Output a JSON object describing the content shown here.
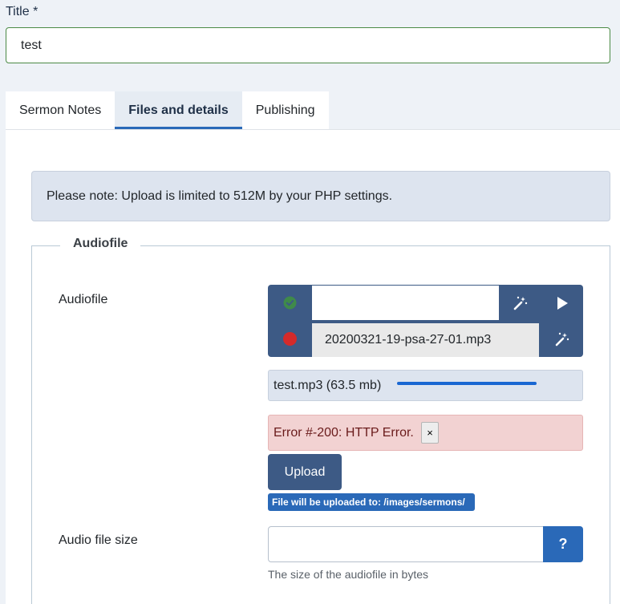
{
  "title_field": {
    "label": "Title *",
    "value": "test"
  },
  "tabs": [
    {
      "label": "Sermon Notes",
      "active": false
    },
    {
      "label": "Files and details",
      "active": true
    },
    {
      "label": "Publishing",
      "active": false
    }
  ],
  "notice": "Please note: Upload is limited to 512M by your PHP settings.",
  "fieldset": {
    "legend": "Audiofile",
    "audiofile": {
      "label": "Audiofile",
      "url_value": "",
      "local_file_value": "20200321-19-psa-27-01.mp3",
      "status_ok_icon": "check-circle-icon",
      "status_error_icon": "red-dot-icon",
      "upload_progress": {
        "text": "test.mp3 (63.5 mb)",
        "percent": 100
      },
      "error": {
        "text": "Error #-200: HTTP Error.",
        "close": "×"
      },
      "upload_button": "Upload",
      "upload_path": "File will be uploaded to: /images/sermons/"
    },
    "audio_file_size": {
      "label": "Audio file size",
      "value": "",
      "help_button": "?",
      "hint": "The size of the audiofile in bytes"
    }
  },
  "colors": {
    "primary": "#3d5a85",
    "accent": "#2a69b8",
    "success": "#3f8a4a",
    "danger": "#d42a2a",
    "progress": "#1967d2"
  }
}
